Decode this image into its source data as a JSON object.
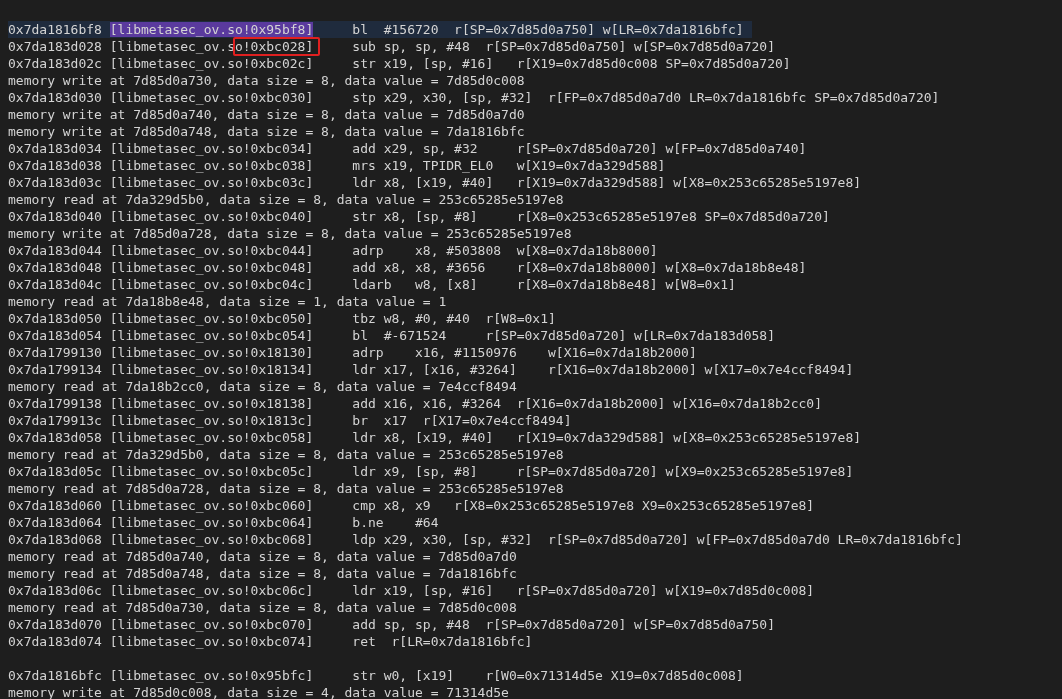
{
  "lines": [
    {
      "kind": "instr",
      "address": "0x7da1816bf8",
      "module": "[libmetasec_ov.so!0x95bf8]",
      "instruction": "bl  #156720  r[SP=0x7d85d0a750] w[LR=0x7da1816bfc]",
      "selected": true,
      "match": true,
      "annotated": false
    },
    {
      "kind": "instr",
      "address": "0x7da183d028",
      "module": "[libmetasec_ov.so!0xbc028]",
      "instruction": "sub sp, sp, #48  r[SP=0x7d85d0a750] w[SP=0x7d85d0a720]",
      "selected": false,
      "match": false,
      "annotated": true
    },
    {
      "kind": "instr",
      "address": "0x7da183d02c",
      "module": "[libmetasec_ov.so!0xbc02c]",
      "instruction": "str x19, [sp, #16]   r[X19=0x7d85d0c008 SP=0x7d85d0a720]",
      "selected": false,
      "match": false,
      "annotated": false
    },
    {
      "kind": "memory",
      "text": "memory write at 7d85d0a730, data size = 8, data value = 7d85d0c008",
      "selected": false
    },
    {
      "kind": "instr",
      "address": "0x7da183d030",
      "module": "[libmetasec_ov.so!0xbc030]",
      "instruction": "stp x29, x30, [sp, #32]  r[FP=0x7d85d0a7d0 LR=0x7da1816bfc SP=0x7d85d0a720]",
      "selected": false,
      "match": false,
      "annotated": false
    },
    {
      "kind": "memory",
      "text": "memory write at 7d85d0a740, data size = 8, data value = 7d85d0a7d0",
      "selected": false
    },
    {
      "kind": "memory",
      "text": "memory write at 7d85d0a748, data size = 8, data value = 7da1816bfc",
      "selected": false
    },
    {
      "kind": "instr",
      "address": "0x7da183d034",
      "module": "[libmetasec_ov.so!0xbc034]",
      "instruction": "add x29, sp, #32     r[SP=0x7d85d0a720] w[FP=0x7d85d0a740]",
      "selected": false,
      "match": false,
      "annotated": false
    },
    {
      "kind": "instr",
      "address": "0x7da183d038",
      "module": "[libmetasec_ov.so!0xbc038]",
      "instruction": "mrs x19, TPIDR_EL0   w[X19=0x7da329d588]",
      "selected": false,
      "match": false,
      "annotated": false
    },
    {
      "kind": "instr",
      "address": "0x7da183d03c",
      "module": "[libmetasec_ov.so!0xbc03c]",
      "instruction": "ldr x8, [x19, #40]   r[X19=0x7da329d588] w[X8=0x253c65285e5197e8]",
      "selected": false,
      "match": false,
      "annotated": false
    },
    {
      "kind": "memory",
      "text": "memory read at 7da329d5b0, data size = 8, data value = 253c65285e5197e8",
      "selected": false
    },
    {
      "kind": "instr",
      "address": "0x7da183d040",
      "module": "[libmetasec_ov.so!0xbc040]",
      "instruction": "str x8, [sp, #8]     r[X8=0x253c65285e5197e8 SP=0x7d85d0a720]",
      "selected": false,
      "match": false,
      "annotated": false
    },
    {
      "kind": "memory",
      "text": "memory write at 7d85d0a728, data size = 8, data value = 253c65285e5197e8",
      "selected": false
    },
    {
      "kind": "instr",
      "address": "0x7da183d044",
      "module": "[libmetasec_ov.so!0xbc044]",
      "instruction": "adrp    x8, #503808  w[X8=0x7da18b8000]",
      "selected": false,
      "match": false,
      "annotated": false
    },
    {
      "kind": "instr",
      "address": "0x7da183d048",
      "module": "[libmetasec_ov.so!0xbc048]",
      "instruction": "add x8, x8, #3656    r[X8=0x7da18b8000] w[X8=0x7da18b8e48]",
      "selected": false,
      "match": false,
      "annotated": false
    },
    {
      "kind": "instr",
      "address": "0x7da183d04c",
      "module": "[libmetasec_ov.so!0xbc04c]",
      "instruction": "ldarb   w8, [x8]     r[X8=0x7da18b8e48] w[W8=0x1]",
      "selected": false,
      "match": false,
      "annotated": false
    },
    {
      "kind": "memory",
      "text": "memory read at 7da18b8e48, data size = 1, data value = 1",
      "selected": false
    },
    {
      "kind": "instr",
      "address": "0x7da183d050",
      "module": "[libmetasec_ov.so!0xbc050]",
      "instruction": "tbz w8, #0, #40  r[W8=0x1]",
      "selected": false,
      "match": false,
      "annotated": false
    },
    {
      "kind": "instr",
      "address": "0x7da183d054",
      "module": "[libmetasec_ov.so!0xbc054]",
      "instruction": "bl  #-671524     r[SP=0x7d85d0a720] w[LR=0x7da183d058]",
      "selected": false,
      "match": false,
      "annotated": false
    },
    {
      "kind": "instr",
      "address": "0x7da1799130",
      "module": "[libmetasec_ov.so!0x18130]",
      "instruction": "adrp    x16, #1150976    w[X16=0x7da18b2000]",
      "selected": false,
      "match": false,
      "annotated": false
    },
    {
      "kind": "instr",
      "address": "0x7da1799134",
      "module": "[libmetasec_ov.so!0x18134]",
      "instruction": "ldr x17, [x16, #3264]    r[X16=0x7da18b2000] w[X17=0x7e4ccf8494]",
      "selected": false,
      "match": false,
      "annotated": false
    },
    {
      "kind": "memory",
      "text": "memory read at 7da18b2cc0, data size = 8, data value = 7e4ccf8494",
      "selected": false
    },
    {
      "kind": "instr",
      "address": "0x7da1799138",
      "module": "[libmetasec_ov.so!0x18138]",
      "instruction": "add x16, x16, #3264  r[X16=0x7da18b2000] w[X16=0x7da18b2cc0]",
      "selected": false,
      "match": false,
      "annotated": false
    },
    {
      "kind": "instr",
      "address": "0x7da179913c",
      "module": "[libmetasec_ov.so!0x1813c]",
      "instruction": "br  x17  r[X17=0x7e4ccf8494]",
      "selected": false,
      "match": false,
      "annotated": false
    },
    {
      "kind": "instr",
      "address": "0x7da183d058",
      "module": "[libmetasec_ov.so!0xbc058]",
      "instruction": "ldr x8, [x19, #40]   r[X19=0x7da329d588] w[X8=0x253c65285e5197e8]",
      "selected": false,
      "match": false,
      "annotated": false
    },
    {
      "kind": "memory",
      "text": "memory read at 7da329d5b0, data size = 8, data value = 253c65285e5197e8",
      "selected": false
    },
    {
      "kind": "instr",
      "address": "0x7da183d05c",
      "module": "[libmetasec_ov.so!0xbc05c]",
      "instruction": "ldr x9, [sp, #8]     r[SP=0x7d85d0a720] w[X9=0x253c65285e5197e8]",
      "selected": false,
      "match": false,
      "annotated": false
    },
    {
      "kind": "memory",
      "text": "memory read at 7d85d0a728, data size = 8, data value = 253c65285e5197e8",
      "selected": false
    },
    {
      "kind": "instr",
      "address": "0x7da183d060",
      "module": "[libmetasec_ov.so!0xbc060]",
      "instruction": "cmp x8, x9   r[X8=0x253c65285e5197e8 X9=0x253c65285e5197e8]",
      "selected": false,
      "match": false,
      "annotated": false
    },
    {
      "kind": "instr",
      "address": "0x7da183d064",
      "module": "[libmetasec_ov.so!0xbc064]",
      "instruction": "b.ne    #64",
      "selected": false,
      "match": false,
      "annotated": false
    },
    {
      "kind": "instr",
      "address": "0x7da183d068",
      "module": "[libmetasec_ov.so!0xbc068]",
      "instruction": "ldp x29, x30, [sp, #32]  r[SP=0x7d85d0a720] w[FP=0x7d85d0a7d0 LR=0x7da1816bfc]",
      "selected": false,
      "match": false,
      "annotated": false
    },
    {
      "kind": "memory",
      "text": "memory read at 7d85d0a740, data size = 8, data value = 7d85d0a7d0",
      "selected": false
    },
    {
      "kind": "memory",
      "text": "memory read at 7d85d0a748, data size = 8, data value = 7da1816bfc",
      "selected": false
    },
    {
      "kind": "instr",
      "address": "0x7da183d06c",
      "module": "[libmetasec_ov.so!0xbc06c]",
      "instruction": "ldr x19, [sp, #16]   r[SP=0x7d85d0a720] w[X19=0x7d85d0c008]",
      "selected": false,
      "match": false,
      "annotated": false
    },
    {
      "kind": "memory",
      "text": "memory read at 7d85d0a730, data size = 8, data value = 7d85d0c008",
      "selected": false
    },
    {
      "kind": "instr",
      "address": "0x7da183d070",
      "module": "[libmetasec_ov.so!0xbc070]",
      "instruction": "add sp, sp, #48  r[SP=0x7d85d0a720] w[SP=0x7d85d0a750]",
      "selected": false,
      "match": false,
      "annotated": false
    },
    {
      "kind": "instr",
      "address": "0x7da183d074",
      "module": "[libmetasec_ov.so!0xbc074]",
      "instruction": "ret  r[LR=0x7da1816bfc]",
      "selected": false,
      "match": false,
      "annotated": false
    },
    {
      "kind": "blank"
    },
    {
      "kind": "instr",
      "address": "0x7da1816bfc",
      "module": "[libmetasec_ov.so!0x95bfc]",
      "instruction": "str w0, [x19]    r[W0=0x71314d5e X19=0x7d85d0c008]",
      "selected": false,
      "match": false,
      "annotated": false
    },
    {
      "kind": "memory",
      "text": "memory write at 7d85d0c008, data size = 4, data value = 71314d5e",
      "selected": false
    }
  ]
}
